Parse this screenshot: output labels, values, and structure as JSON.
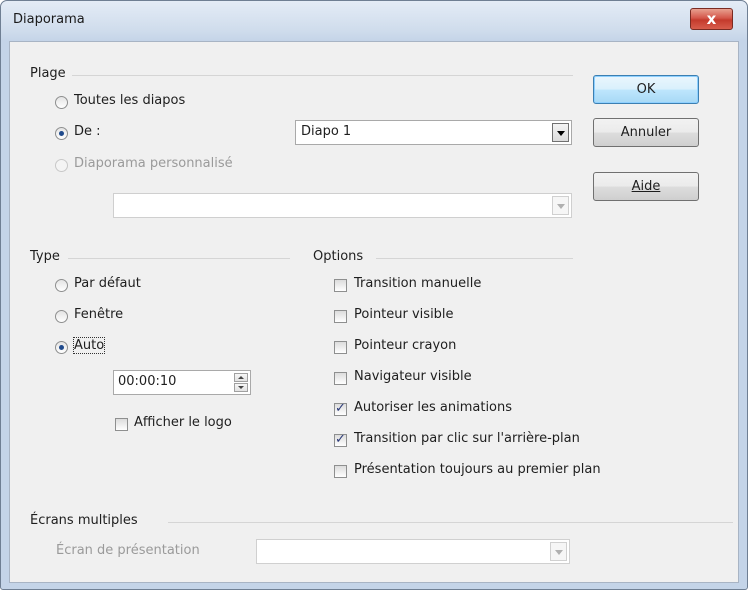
{
  "window": {
    "title": "Diaporama",
    "close_glyph": "x"
  },
  "plage": {
    "heading": "Plage",
    "all_slides": "Toutes les diapos",
    "from": "De :",
    "from_value": "Diapo 1",
    "custom": "Diaporama personnalisé",
    "custom_value": ""
  },
  "buttons": {
    "ok": "OK",
    "cancel": "Annuler",
    "help": "Aide"
  },
  "type": {
    "heading": "Type",
    "default": "Par défaut",
    "window": "Fenêtre",
    "auto": "Auto",
    "pause": "00:00:10",
    "show_logo": "Afficher le logo"
  },
  "options": {
    "heading": "Options",
    "manual_transition": "Transition manuelle",
    "pointer_visible": "Pointeur visible",
    "pointer_pen": "Pointeur crayon",
    "navigator_visible": "Navigateur visible",
    "allow_animations": "Autoriser les animations",
    "click_transition": "Transition par clic sur l'arrière-plan",
    "always_on_top": "Présentation toujours au premier plan"
  },
  "screens": {
    "heading": "Écrans multiples",
    "presentation_screen": "Écran de présentation",
    "presentation_screen_value": ""
  },
  "state": {
    "range": "from",
    "type": "auto",
    "show_logo": false,
    "manual_transition": false,
    "pointer_visible": false,
    "pointer_pen": false,
    "navigator_visible": false,
    "allow_animations": true,
    "click_transition": true,
    "always_on_top": false
  }
}
